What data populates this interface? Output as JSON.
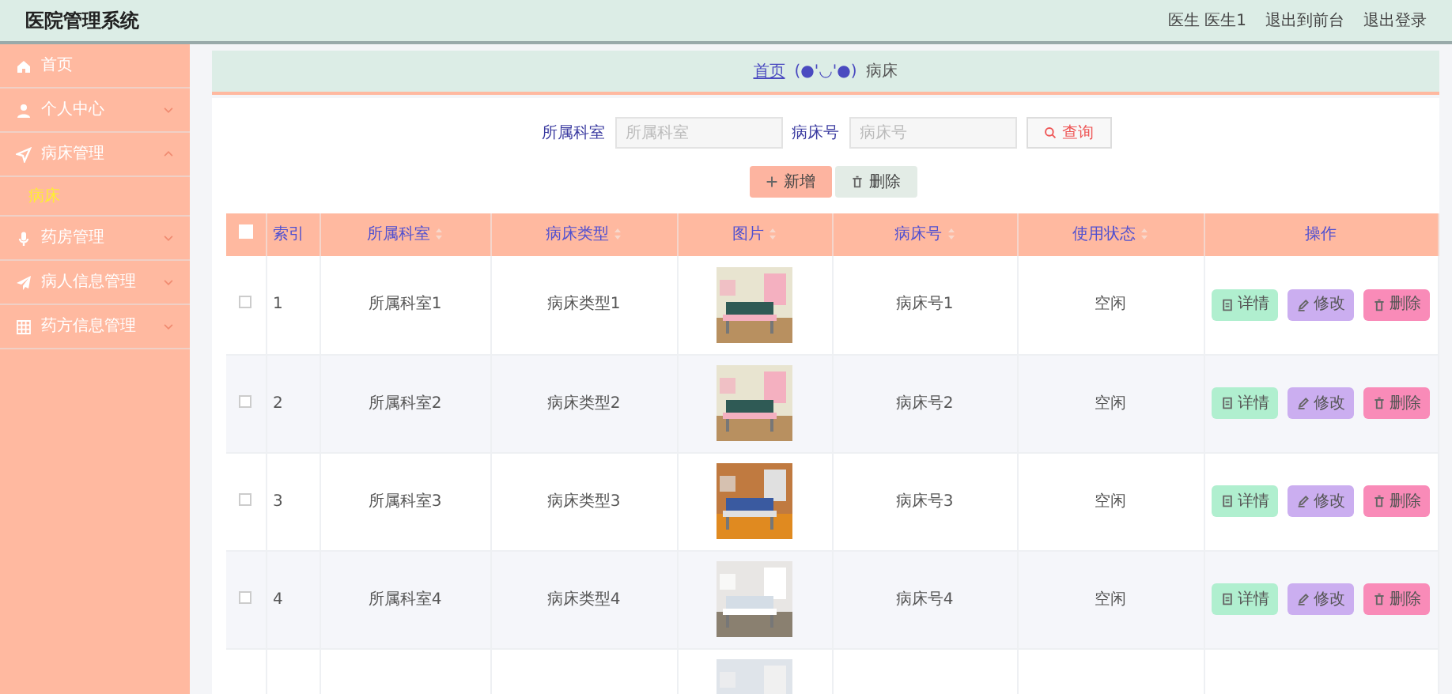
{
  "header": {
    "title": "医院管理系统",
    "user": "医生 医生1",
    "links": [
      "退出到前台",
      "退出登录"
    ]
  },
  "sidebar": {
    "items": [
      {
        "label": "首页"
      },
      {
        "label": "个人中心",
        "expanded": false
      },
      {
        "label": "病床管理",
        "expanded": true,
        "children": [
          {
            "label": "病床",
            "selected": true
          }
        ]
      },
      {
        "label": "药房管理",
        "expanded": false
      },
      {
        "label": "病人信息管理",
        "expanded": false
      },
      {
        "label": "药方信息管理",
        "expanded": false
      }
    ]
  },
  "breadcrumb": {
    "home": "首页",
    "separator": "(●'◡'●)",
    "current": "病床"
  },
  "search": {
    "fields": [
      {
        "label": "所属科室",
        "placeholder": "所属科室"
      },
      {
        "label": "病床号",
        "placeholder": "病床号"
      }
    ],
    "button": "查询"
  },
  "toolbar": [
    {
      "label": "新增",
      "kind": "add"
    },
    {
      "label": "删除",
      "kind": "delete"
    }
  ],
  "table": {
    "select_all_checked": false,
    "columns": [
      {
        "label": "索引",
        "sortable": false
      },
      {
        "label": "所属科室",
        "sortable": true
      },
      {
        "label": "病床类型",
        "sortable": true
      },
      {
        "label": "图片",
        "sortable": true
      },
      {
        "label": "病床号",
        "sortable": true
      },
      {
        "label": "使用状态",
        "sortable": true
      },
      {
        "label": "操作",
        "sortable": false
      }
    ],
    "rows": [
      {
        "index": "1",
        "department": "所属科室1",
        "bed_type": "病床类型1",
        "image": {
          "kind": "picture"
        },
        "bed_no": "病床号1",
        "status": "空闲",
        "checked": false,
        "actions": [
          {
            "label": "详情",
            "kind": "detail"
          },
          {
            "label": "修改",
            "kind": "edit"
          },
          {
            "label": "删除",
            "kind": "delete"
          }
        ]
      },
      {
        "index": "2",
        "department": "所属科室2",
        "bed_type": "病床类型2",
        "image": {
          "kind": "picture"
        },
        "bed_no": "病床号2",
        "status": "空闲",
        "checked": false,
        "actions": [
          {
            "label": "详情",
            "kind": "detail"
          },
          {
            "label": "修改",
            "kind": "edit"
          },
          {
            "label": "删除",
            "kind": "delete"
          }
        ]
      },
      {
        "index": "3",
        "department": "所属科室3",
        "bed_type": "病床类型3",
        "image": {
          "kind": "picture"
        },
        "bed_no": "病床号3",
        "status": "空闲",
        "checked": false,
        "actions": [
          {
            "label": "详情",
            "kind": "detail"
          },
          {
            "label": "修改",
            "kind": "edit"
          },
          {
            "label": "删除",
            "kind": "delete"
          }
        ]
      },
      {
        "index": "4",
        "department": "所属科室4",
        "bed_type": "病床类型4",
        "image": {
          "kind": "picture"
        },
        "bed_no": "病床号4",
        "status": "空闲",
        "checked": false,
        "actions": [
          {
            "label": "详情",
            "kind": "detail"
          },
          {
            "label": "修改",
            "kind": "edit"
          },
          {
            "label": "删除",
            "kind": "delete"
          }
        ]
      },
      {
        "image": {
          "kind": "picture"
        }
      }
    ]
  }
}
